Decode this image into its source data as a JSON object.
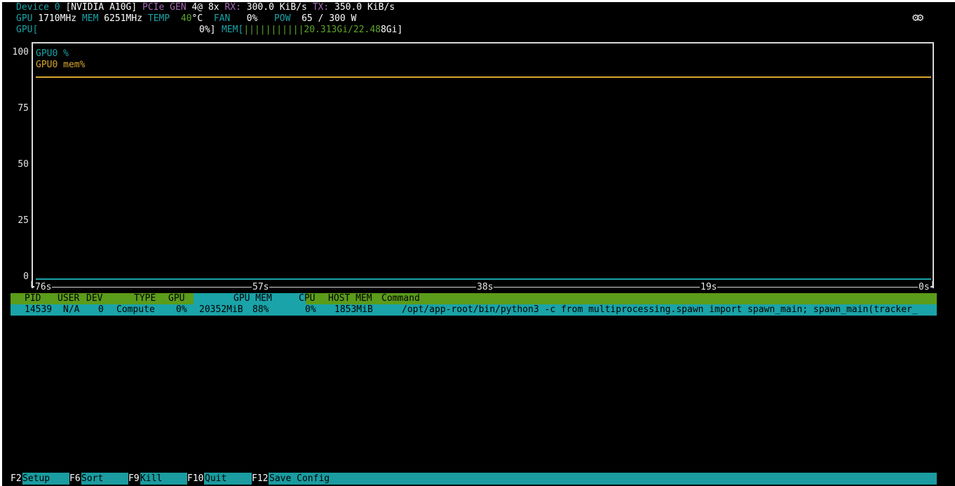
{
  "device": {
    "label": "Device 0",
    "name": "[NVIDIA A10G]",
    "pcie_label": "PCIe GEN",
    "pcie_gen": "4@ 8x",
    "rx_label": "RX:",
    "rx_value": "300.0 KiB/s",
    "tx_label": "TX:",
    "tx_value": "350.0 KiB/s"
  },
  "stats": {
    "gpu_label": "GPU",
    "gpu_clock": "1710MHz",
    "mem_label": "MEM",
    "mem_clock": "6251MHz",
    "temp_label": "TEMP",
    "temp_value": "40",
    "temp_unit": "°C",
    "fan_label": "FAN",
    "fan_value": "0%",
    "pow_label": "POW",
    "pow_value": "65 / 300 W"
  },
  "bars": {
    "gpu_label": "GPU[",
    "gpu_value": "0%]",
    "mem_label": "MEM[",
    "mem_bars": "|||||||||||",
    "mem_used": "20.313Gi/22.48",
    "mem_tail": "8Gi]",
    "gpu_util_fraction": 0.0,
    "mem_fraction": 0.88
  },
  "chart_data": {
    "type": "line",
    "x_ticks": [
      "76s",
      "57s",
      "38s",
      "19s",
      "0s"
    ],
    "y_ticks": [
      "100",
      "75",
      "50",
      "25",
      "0"
    ],
    "ylim": [
      0,
      100
    ],
    "series": [
      {
        "name": "GPU0 %",
        "color": "#1aa3a8",
        "value": 0
      },
      {
        "name": "GPU0 mem%",
        "color": "#d8a62e",
        "value": 90
      }
    ]
  },
  "table": {
    "columns": [
      "PID",
      "USER",
      "DEV",
      "TYPE",
      "GPU",
      "GPU MEM",
      "CPU",
      "HOST MEM",
      "Command"
    ],
    "rows": [
      {
        "pid": "14539",
        "user": "N/A",
        "dev": "0",
        "type": "Compute",
        "gpu": "0%",
        "gpu_mem": "20352MiB",
        "gpu_mem_pct": "88%",
        "cpu": "0%",
        "host_mem": "1853MiB",
        "command": "/opt/app-root/bin/python3 -c from multiprocessing.spawn import spawn_main; spawn_main(tracker_"
      }
    ]
  },
  "fkeys": [
    {
      "key": "F2",
      "label": "Setup"
    },
    {
      "key": "F6",
      "label": "Sort"
    },
    {
      "key": "F9",
      "label": "Kill"
    },
    {
      "key": "F10",
      "label": "Quit"
    },
    {
      "key": "F12",
      "label": "Save Config"
    }
  ],
  "icons": {
    "settings": "gear-icon"
  },
  "colors": {
    "cyan": "#1aa3a8",
    "green": "#5b9c1a",
    "yellow": "#d8a62e",
    "purple": "#a66ab6"
  }
}
